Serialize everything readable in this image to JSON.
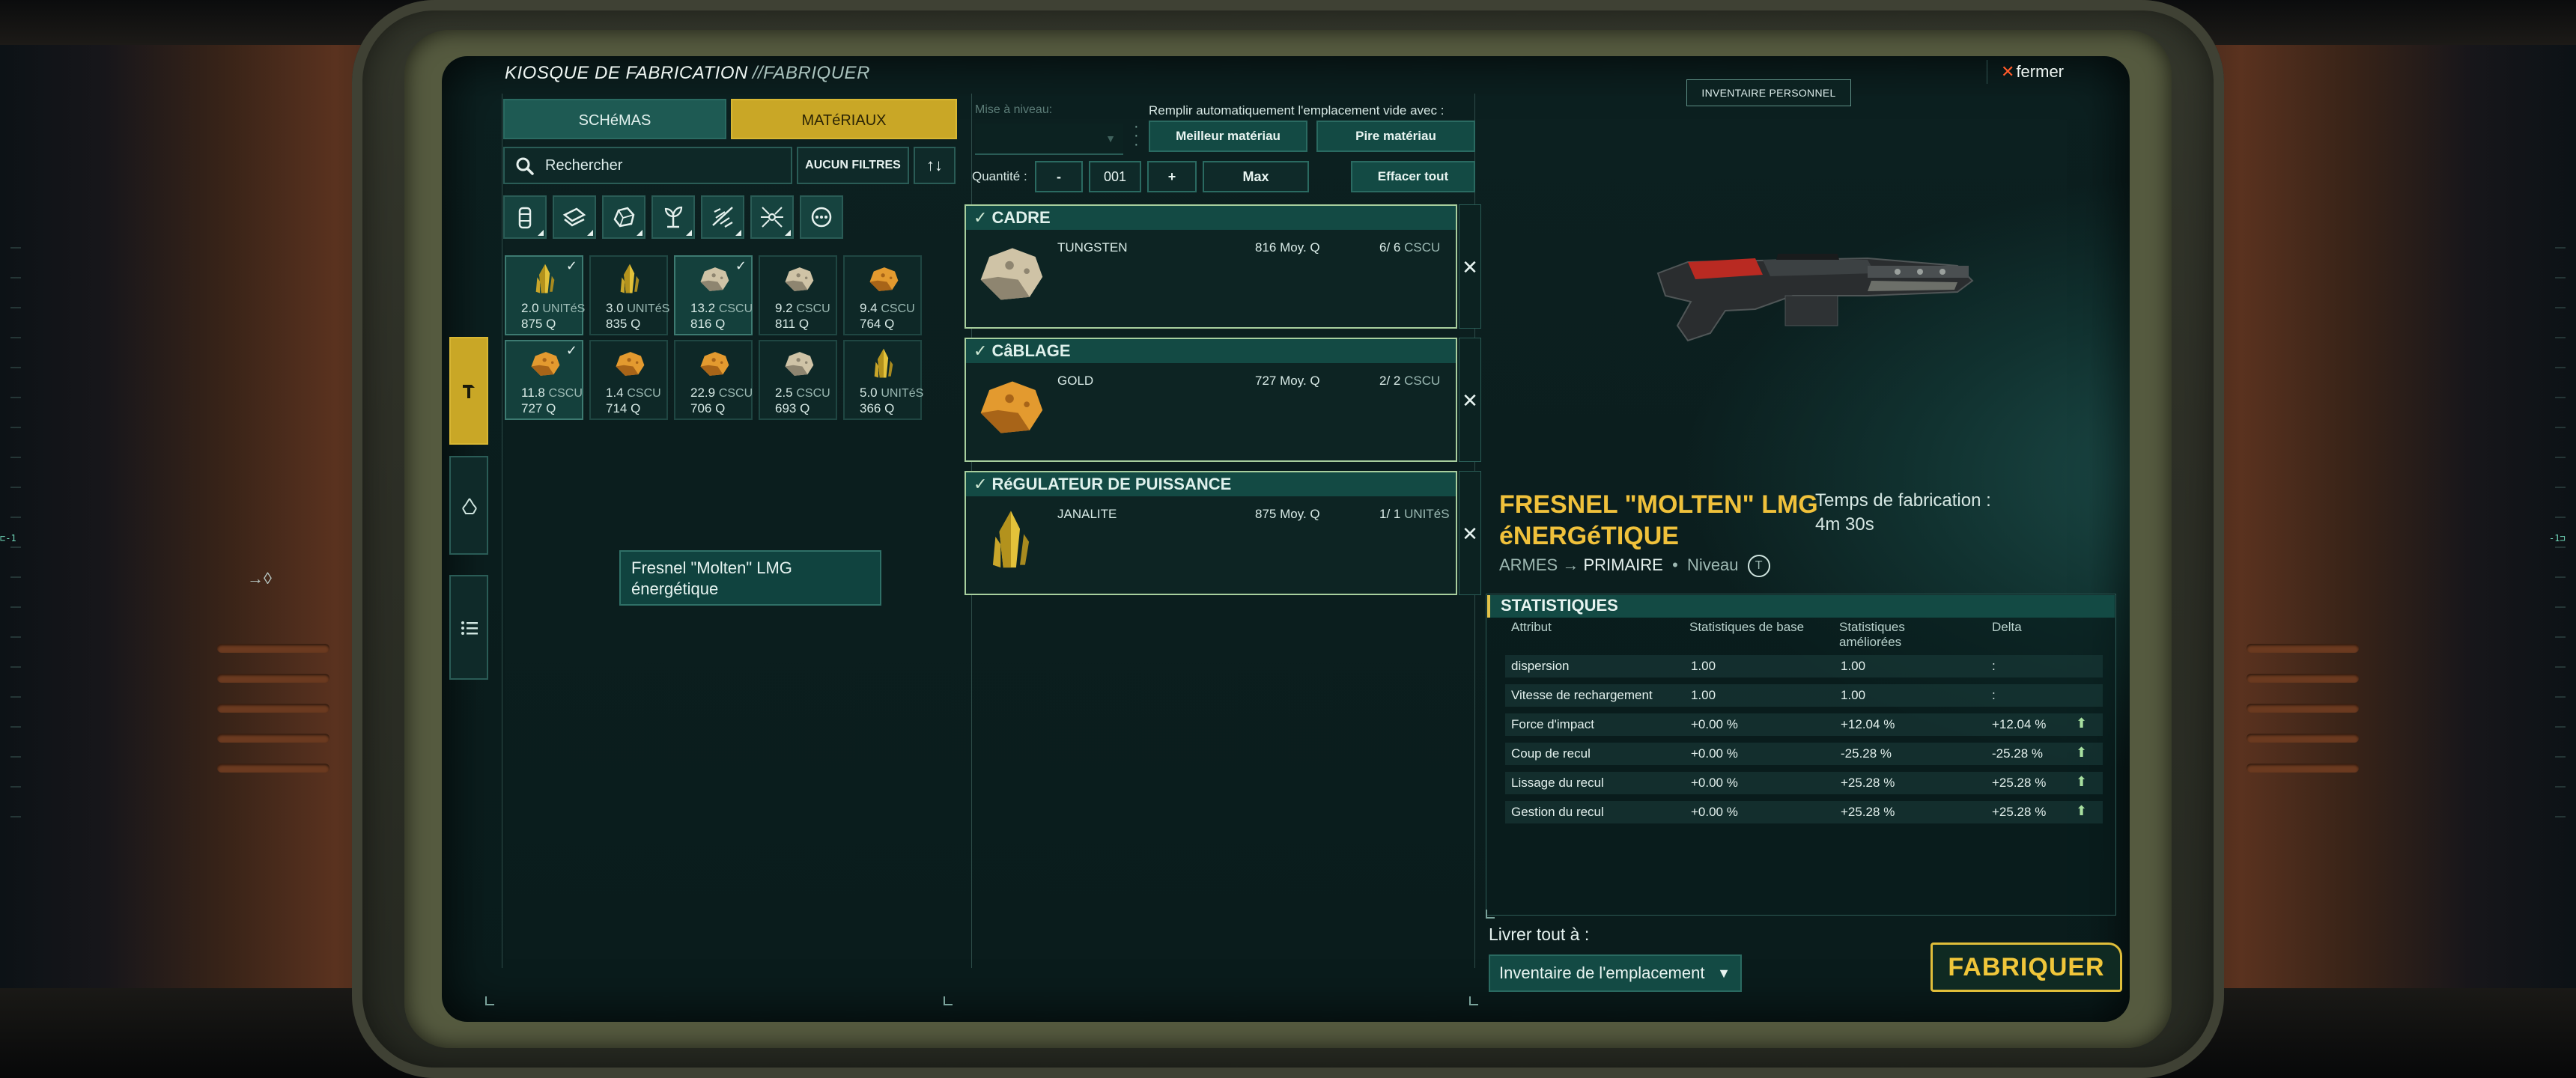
{
  "window": {
    "title": "KIOSQUE DE FABRICATION",
    "subtitle": "//FABRIQUER",
    "close_label": "fermer"
  },
  "left": {
    "tabs": [
      {
        "label": "SCHéMAS",
        "active": false
      },
      {
        "label": "MATéRIAUX",
        "active": true
      }
    ],
    "search_placeholder": "Rechercher",
    "filter_label": "AUCUN FILTRES",
    "category_icons": [
      "canister-icon",
      "plank-icon",
      "ore-icon",
      "plant-icon",
      "scrap-icon",
      "component-icon",
      "more-icon"
    ],
    "materials": [
      {
        "qty": "2.0",
        "unit": "UNITéS",
        "quality": "875 Q",
        "type": "crystal",
        "selected": true
      },
      {
        "qty": "3.0",
        "unit": "UNITéS",
        "quality": "835 Q",
        "type": "crystal",
        "selected": false
      },
      {
        "qty": "13.2",
        "unit": "CSCU",
        "quality": "816 Q",
        "type": "rock-light",
        "selected": true
      },
      {
        "qty": "9.2",
        "unit": "CSCU",
        "quality": "811 Q",
        "type": "rock-light",
        "selected": false
      },
      {
        "qty": "9.4",
        "unit": "CSCU",
        "quality": "764 Q",
        "type": "rock-gold",
        "selected": false
      },
      {
        "qty": "11.8",
        "unit": "CSCU",
        "quality": "727 Q",
        "type": "rock-gold",
        "selected": true
      },
      {
        "qty": "1.4",
        "unit": "CSCU",
        "quality": "714 Q",
        "type": "rock-gold",
        "selected": false
      },
      {
        "qty": "22.9",
        "unit": "CSCU",
        "quality": "706 Q",
        "type": "rock-gold",
        "selected": false
      },
      {
        "qty": "2.5",
        "unit": "CSCU",
        "quality": "693 Q",
        "type": "rock-light",
        "selected": false
      },
      {
        "qty": "5.0",
        "unit": "UNITéS",
        "quality": "366 Q",
        "type": "crystal",
        "selected": false
      }
    ],
    "side_tabs": [
      "hammer-icon",
      "recycle-icon",
      "list-icon"
    ],
    "tooltip": "Fresnel \"Molten\" LMG énergétique"
  },
  "middle": {
    "level_label": "Mise à niveau:",
    "autofill_label": "Remplir automatiquement l'emplacement vide avec :",
    "best_material": "Meilleur matériau",
    "worst_material": "Pire matériau",
    "quantity_label": "Quantité :",
    "minus": "-",
    "quantity_value": "001",
    "plus": "+",
    "max": "Max",
    "clear_all": "Effacer tout",
    "slots": [
      {
        "title": "CADRE",
        "material": "TUNGSTEN",
        "quality": "816 Moy. Q",
        "count": "6/ 6",
        "unit": "CSCU",
        "ore": "rock-light"
      },
      {
        "title": "CâBLAGE",
        "material": "GOLD",
        "quality": "727 Moy. Q",
        "count": "2/ 2",
        "unit": "CSCU",
        "ore": "rock-gold"
      },
      {
        "title": "RéGULATEUR DE PUISSANCE",
        "material": "JANALITE",
        "quality": "875 Moy. Q",
        "count": "1/ 1",
        "unit": "UNITéS",
        "ore": "crystal"
      }
    ]
  },
  "right": {
    "inventory_tag": "INVENTAIRE PERSONNEL",
    "item_name": "FRESNEL \"MOLTEN\" LMG éNERGéTIQUE",
    "craft_time_label": "Temps de fabrication :",
    "craft_time_value": "4m 30s",
    "category": "ARMES",
    "category_arrow": "→",
    "subcategory": "PRIMAIRE",
    "level_label": "Niveau",
    "tier": "T",
    "stats_title": "STATISTIQUES",
    "stats_columns": [
      "Attribut",
      "Statistiques de base",
      "Statistiques améliorées",
      "Delta"
    ],
    "stats": [
      {
        "attr": "dispersion",
        "base": "1.00",
        "improved": "1.00",
        "delta": ":",
        "up": false
      },
      {
        "attr": "Vitesse de rechargement",
        "base": "1.00",
        "improved": "1.00",
        "delta": ":",
        "up": false
      },
      {
        "attr": "Force d'impact",
        "base": "+0.00 %",
        "improved": "+12.04 %",
        "delta": "+12.04 %",
        "up": true
      },
      {
        "attr": "Coup de recul",
        "base": "+0.00 %",
        "improved": "-25.28 %",
        "delta": "-25.28 %",
        "up": true
      },
      {
        "attr": "Lissage du recul",
        "base": "+0.00 %",
        "improved": "+25.28 %",
        "delta": "+25.28 %",
        "up": true
      },
      {
        "attr": "Gestion du recul",
        "base": "+0.00 %",
        "improved": "+25.28 %",
        "delta": "+25.28 %",
        "up": true
      }
    ],
    "deliver_label": "Livrer tout à :",
    "deliver_value": "Inventaire de l'emplacement",
    "craft_button": "FABRIQUER"
  },
  "colors": {
    "accent_gold": "#c9a726",
    "teal": "#134a44",
    "up_green": "#a8e0a0",
    "close_x": "#ff5a2a"
  }
}
